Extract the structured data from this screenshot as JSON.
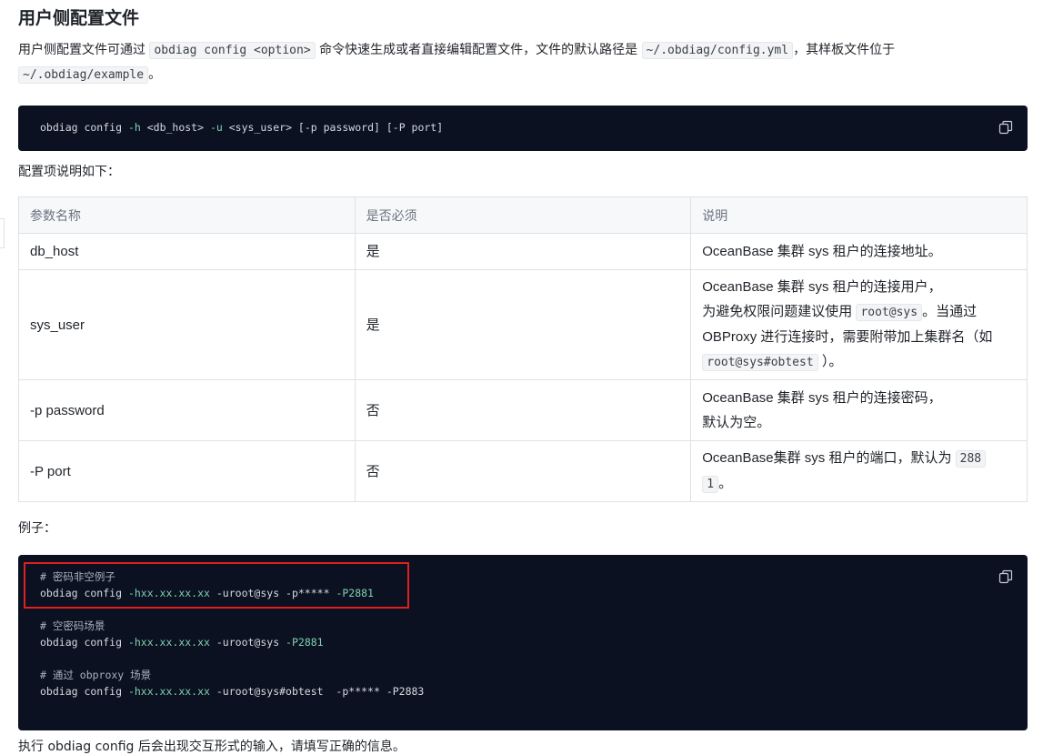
{
  "title": "用户侧配置文件",
  "intro": {
    "t1": "用户侧配置文件可通过",
    "c1": "obdiag config <option>",
    "t2": "命令快速生成或者直接编辑配置文件，文件的默认路径是",
    "c2": "~/.obdiag/config.yml",
    "t3": "，其样板文件位于",
    "c3": "~/.obdiag/example",
    "t4": "。"
  },
  "code1": {
    "cmd": "obdiag config ",
    "f1": "-h",
    "a1": " <db_host> ",
    "f2": "-u",
    "a2": " <sys_user> [-p password] [-P port]"
  },
  "config_label": "配置项说明如下：",
  "table": {
    "headers": [
      "参数名称",
      "是否必须",
      "说明"
    ],
    "rows": [
      {
        "name": "db_host",
        "required": "是",
        "desc": "OceanBase 集群 sys 租户的连接地址。"
      },
      {
        "name": "sys_user",
        "required": "是",
        "desc_l1": "OceanBase 集群 sys 租户的连接用户，",
        "desc_l2a": "为避免权限问题建议使用",
        "desc_code1": "root@sys",
        "desc_l2b": "。当通过",
        "desc_l3": "OBProxy 进行连接时，需要附带加上集群名（如",
        "desc_code2": "root@sys#obtest",
        "desc_l4": "）。"
      },
      {
        "name": "-p password",
        "required": "否",
        "desc_l1": "OceanBase 集群 sys 租户的连接密码，",
        "desc_l2": "默认为空。"
      },
      {
        "name": "-P port",
        "required": "否",
        "desc_l1": "OceanBase集群 sys 租户的端口，默认为",
        "desc_code1": "288",
        "desc_code2": "1",
        "desc_l2": "。"
      }
    ]
  },
  "example_label": "例子：",
  "code2": {
    "c1": "# 密码非空例子",
    "l1_cmd": "obdiag config ",
    "l1_h": "-hxx.xx.xx.xx",
    "l1_u": " -uroot@sys -p***** ",
    "l1_p": "-P2881",
    "c2": "# 空密码场景",
    "l2_cmd": "obdiag config ",
    "l2_h": "-hxx.xx.xx.xx",
    "l2_u": " -uroot@sys ",
    "l2_p": "-P2881",
    "c3": "# 通过 obproxy 场景",
    "l3_cmd": "obdiag config ",
    "l3_h": "-hxx.xx.xx.xx",
    "l3_u": " -uroot@sys#obtest  -p***** -P2883"
  },
  "trailing_text": "执行 obdiag config 后会出现交互形式的输入，请填写正确的信息。",
  "icons": {
    "copy": "copy-icon"
  },
  "colors": {
    "code_bg": "#0b1120",
    "highlight_box": "#e02020",
    "flag": "#7fd1b0"
  }
}
